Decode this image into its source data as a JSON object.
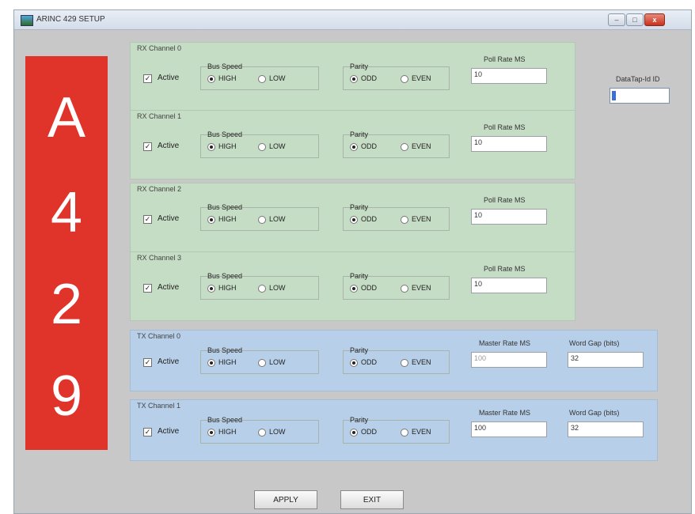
{
  "window": {
    "title": "ARINC 429 SETUP",
    "controls": {
      "minimize": "–",
      "maximize": "□",
      "close": "x"
    }
  },
  "logo": [
    "A",
    "4",
    "2",
    "9"
  ],
  "datatap": {
    "label": "DataTap-Id ID",
    "value": ""
  },
  "rx_channels": [
    {
      "title": "RX Channel 0",
      "active_label": "Active",
      "active": true,
      "bus_speed_label": "Bus Speed",
      "speed_high": "HIGH",
      "speed_low": "LOW",
      "selected_speed": "HIGH",
      "parity_label": "Parity",
      "parity_odd": "ODD",
      "parity_even": "EVEN",
      "selected_parity": "ODD",
      "poll_label": "Poll Rate MS",
      "poll_value": "10"
    },
    {
      "title": "RX Channel 1",
      "active_label": "Active",
      "active": true,
      "bus_speed_label": "Bus Speed",
      "speed_high": "HIGH",
      "speed_low": "LOW",
      "selected_speed": "HIGH",
      "parity_label": "Parity",
      "parity_odd": "ODD",
      "parity_even": "EVEN",
      "selected_parity": "ODD",
      "poll_label": "Poll Rate MS",
      "poll_value": "10"
    },
    {
      "title": "RX Channel 2",
      "active_label": "Active",
      "active": true,
      "bus_speed_label": "Bus Speed",
      "speed_high": "HIGH",
      "speed_low": "LOW",
      "selected_speed": "HIGH",
      "parity_label": "Parity",
      "parity_odd": "ODD",
      "parity_even": "EVEN",
      "selected_parity": "ODD",
      "poll_label": "Poll Rate MS",
      "poll_value": "10"
    },
    {
      "title": "RX Channel 3",
      "active_label": "Active",
      "active": true,
      "bus_speed_label": "Bus Speed",
      "speed_high": "HIGH",
      "speed_low": "LOW",
      "selected_speed": "HIGH",
      "parity_label": "Parity",
      "parity_odd": "ODD",
      "parity_even": "EVEN",
      "selected_parity": "ODD",
      "poll_label": "Poll Rate MS",
      "poll_value": "10"
    }
  ],
  "tx_channels": [
    {
      "title": "TX Channel 0",
      "active_label": "Active",
      "active": true,
      "bus_speed_label": "Bus Speed",
      "speed_high": "HIGH",
      "speed_low": "LOW",
      "selected_speed": "HIGH",
      "parity_label": "Parity",
      "parity_odd": "ODD",
      "parity_even": "EVEN",
      "selected_parity": "ODD",
      "master_label": "Master Rate MS",
      "master_value": "100",
      "gap_label": "Word Gap (bits)",
      "gap_value": "32"
    },
    {
      "title": "TX Channel 1",
      "active_label": "Active",
      "active": true,
      "bus_speed_label": "Bus Speed",
      "speed_high": "HIGH",
      "speed_low": "LOW",
      "selected_speed": "HIGH",
      "parity_label": "Parity",
      "parity_odd": "ODD",
      "parity_even": "EVEN",
      "selected_parity": "ODD",
      "master_label": "Master Rate MS",
      "master_value": "100",
      "gap_label": "Word Gap (bits)",
      "gap_value": "32"
    }
  ],
  "buttons": {
    "apply": "APPLY",
    "exit": "EXIT"
  },
  "colors": {
    "logo": "#e0332a",
    "rx_panel": "#c5dcc5",
    "tx_panel": "#b7cfe8"
  }
}
